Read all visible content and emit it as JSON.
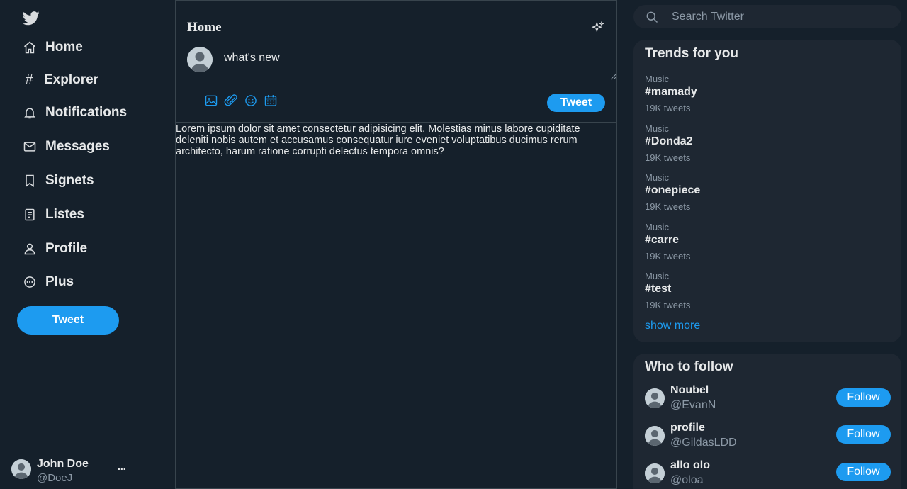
{
  "brand": {
    "accent": "#1d9bf0",
    "background": "#15202b",
    "panel": "#1e2732",
    "logo_icon": "twitter-bird-icon"
  },
  "sidebar": {
    "items": [
      {
        "label": "Home",
        "icon": "home-icon"
      },
      {
        "label": "Explorer",
        "icon": "hash-icon"
      },
      {
        "label": "Notifications",
        "icon": "bell-icon"
      },
      {
        "label": "Messages",
        "icon": "envelope-icon"
      },
      {
        "label": "Signets",
        "icon": "bookmark-icon"
      },
      {
        "label": "Listes",
        "icon": "list-icon"
      },
      {
        "label": "Profile",
        "icon": "person-icon"
      },
      {
        "label": "Plus",
        "icon": "more-circle-icon"
      }
    ],
    "tweet_label": "Tweet",
    "user": {
      "name": "John Doe",
      "handle": "@DoeJ",
      "more": "..."
    }
  },
  "main": {
    "title": "Home",
    "compose_placeholder": "what's new",
    "tweet_label": "Tweet",
    "tools": [
      "image-icon",
      "attach-icon",
      "emoji-icon",
      "calendar-icon"
    ],
    "feed_text": "Lorem ipsum dolor sit amet consectetur adipisicing elit. Molestias minus labore cupiditate deleniti nobis autem et accusamus consequatur iure eveniet voluptatibus ducimus rerum architecto, harum ratione corrupti delectus tempora omnis?"
  },
  "search": {
    "placeholder": "Search Twitter"
  },
  "trends": {
    "title": "Trends for you",
    "items": [
      {
        "category": "Music",
        "tag": "#mamady",
        "count": "19K tweets"
      },
      {
        "category": "Music",
        "tag": "#Donda2",
        "count": "19K tweets"
      },
      {
        "category": "Music",
        "tag": "#onepiece",
        "count": "19K tweets"
      },
      {
        "category": "Music",
        "tag": "#carre",
        "count": "19K tweets"
      },
      {
        "category": "Music",
        "tag": "#test",
        "count": "19K tweets"
      }
    ],
    "show_more": "show more"
  },
  "who_to_follow": {
    "title": "Who to follow",
    "button_label": "Follow",
    "users": [
      {
        "name": "Noubel",
        "handle": "@EvanN"
      },
      {
        "name": "profile",
        "handle": "@GildasLDD"
      },
      {
        "name": "allo olo",
        "handle": "@oloa"
      }
    ]
  }
}
